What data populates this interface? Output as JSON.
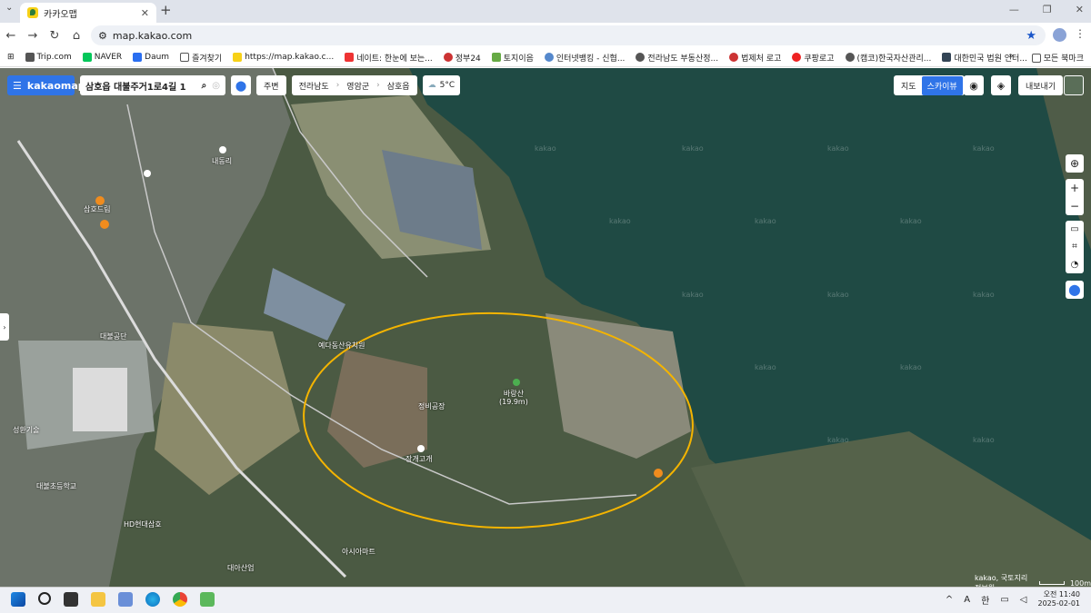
{
  "browser": {
    "tab_title": "카카오맵",
    "url": "map.kakao.com",
    "bookmarks": [
      "Trip.com",
      "NAVER",
      "Daum",
      "즐겨찾기",
      "https://map.kakao.c...",
      "네이트: 한눈에 보는...",
      "정부24",
      "토지이음",
      "인터넷뱅킹 - 신협...",
      "전라남도 부동산정...",
      "법제처 로고",
      "쿠팡로고",
      "(캠코)한국자산관리...",
      "대한민국 법원 인터..."
    ],
    "bookmarks_more": "모든 북마크"
  },
  "map": {
    "logo": "kakaomap",
    "search_value": "삼호읍 대불주거1로4길 1",
    "nearby_label": "주변",
    "breadcrumb": [
      "전라남도",
      "영암군",
      "삼호읍"
    ],
    "weather": "5°C",
    "maptype_map": "지도",
    "maptype_sky": "스카이뷰",
    "export_label": "내보내기",
    "credit": "kakao, 국토지리정보원",
    "scale": "100m",
    "watermark": "kakao",
    "places": [
      {
        "name": "바랑산",
        "sub": "(19.9m)"
      },
      {
        "name": "정비공장"
      },
      {
        "name": "장개고개"
      },
      {
        "name": "예다동산유치원"
      },
      {
        "name": "대불공단"
      },
      {
        "name": "성환기술"
      },
      {
        "name": "대불초등학교"
      },
      {
        "name": "삼호드림"
      },
      {
        "name": "HD현대삼호"
      },
      {
        "name": "아시아마트"
      },
      {
        "name": "대아산업"
      },
      {
        "name": "내동리"
      }
    ],
    "colors": {
      "accent": "#2f74e8",
      "circle": "#f4b400",
      "sea": "#1f4a44"
    }
  },
  "taskbar": {
    "time": "오전 11:40",
    "date": "2025-02-01",
    "ime": "한",
    "lang": "A"
  }
}
